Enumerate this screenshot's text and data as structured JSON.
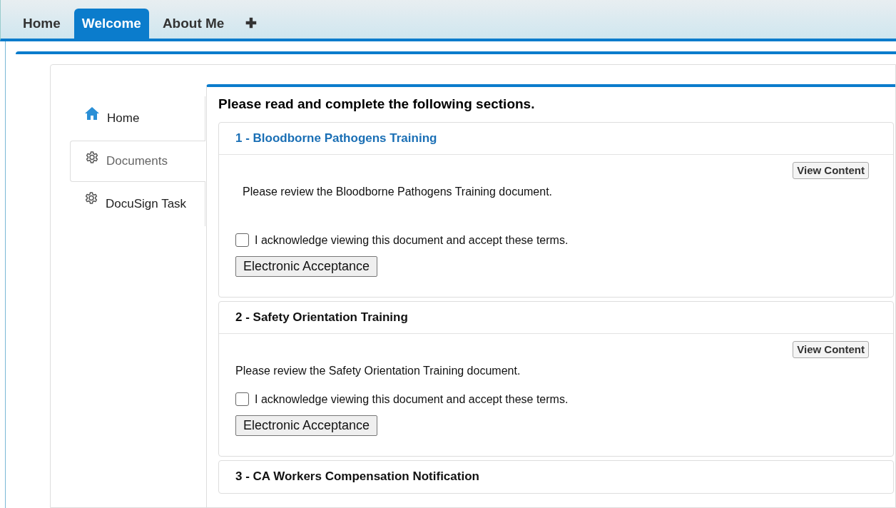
{
  "tabs": [
    {
      "label": "Home",
      "selected": false
    },
    {
      "label": "Welcome",
      "selected": true
    },
    {
      "label": "About Me",
      "selected": false
    },
    {
      "label": "✚",
      "selected": false
    }
  ],
  "sidebar": {
    "items": [
      {
        "label": "Home",
        "kind": "home",
        "selected": false
      },
      {
        "label": "Documents",
        "kind": "gear",
        "selected": true
      },
      {
        "label": "DocuSign Task",
        "kind": "gear",
        "selected": false
      }
    ]
  },
  "heading": "Please read and complete the following sections.",
  "sections": [
    {
      "title": "1 - Bloodborne Pathogens Training",
      "active": true,
      "view_button": "View Content",
      "description": "Please review the Bloodborne Pathogens Training document.",
      "acknowledge": {
        "label": "I acknowledge viewing this document and accept these terms.",
        "checked": false
      },
      "accept_button": "Electronic Acceptance"
    },
    {
      "title": "2 - Safety Orientation Training",
      "active": false,
      "view_button": "View Content",
      "description": "Please review the Safety Orientation Training document.",
      "acknowledge": {
        "label": "I acknowledge viewing this document and accept these terms.",
        "checked": false
      },
      "accept_button": "Electronic Acceptance"
    },
    {
      "title": "3 - CA Workers Compensation Notification",
      "active": false
    }
  ]
}
